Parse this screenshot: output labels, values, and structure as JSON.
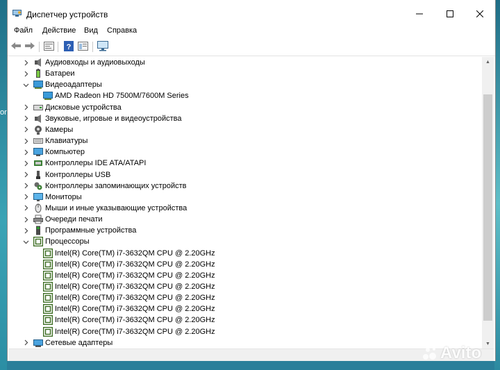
{
  "window": {
    "title": "Диспетчер устройств",
    "icon": "device-manager-icon",
    "controls": [
      "minimize-icon",
      "maximize-icon",
      "close-icon"
    ]
  },
  "menu": [
    "Файл",
    "Действие",
    "Вид",
    "Справка"
  ],
  "toolbar": [
    "back-arrow-icon",
    "forward-arrow-icon",
    "properties-icon",
    "help-icon",
    "view-icon",
    "monitor-scan-icon"
  ],
  "tree": [
    {
      "label": "Аудиовходы и аудиовыходы",
      "icon": "speaker-icon",
      "expanded": false
    },
    {
      "label": "Батареи",
      "icon": "battery-icon",
      "expanded": false
    },
    {
      "label": "Видеоадаптеры",
      "icon": "display-adapter-icon",
      "expanded": true
    },
    {
      "label": "AMD Radeon HD 7500M/7600M Series",
      "icon": "display-adapter-icon",
      "child": true
    },
    {
      "label": "Дисковые устройства",
      "icon": "disk-icon",
      "expanded": false
    },
    {
      "label": "Звуковые, игровые и видеоустройства",
      "icon": "speaker-icon",
      "expanded": false
    },
    {
      "label": "Камеры",
      "icon": "camera-icon",
      "expanded": false
    },
    {
      "label": "Клавиатуры",
      "icon": "keyboard-icon",
      "expanded": false
    },
    {
      "label": "Компьютер",
      "icon": "computer-icon",
      "expanded": false
    },
    {
      "label": "Контроллеры IDE ATA/ATAPI",
      "icon": "ide-controller-icon",
      "expanded": false
    },
    {
      "label": "Контроллеры USB",
      "icon": "usb-icon",
      "expanded": false
    },
    {
      "label": "Контроллеры запоминающих устройств",
      "icon": "storage-controller-icon",
      "expanded": false
    },
    {
      "label": "Мониторы",
      "icon": "monitor-icon",
      "expanded": false
    },
    {
      "label": "Мыши и иные указывающие устройства",
      "icon": "mouse-icon",
      "expanded": false
    },
    {
      "label": "Очереди печати",
      "icon": "printer-icon",
      "expanded": false
    },
    {
      "label": "Программные устройства",
      "icon": "software-device-icon",
      "expanded": false
    },
    {
      "label": "Процессоры",
      "icon": "processor-icon",
      "expanded": true
    },
    {
      "label": "Intel(R) Core(TM) i7-3632QM CPU @ 2.20GHz",
      "icon": "processor-icon",
      "child": true
    },
    {
      "label": "Intel(R) Core(TM) i7-3632QM CPU @ 2.20GHz",
      "icon": "processor-icon",
      "child": true
    },
    {
      "label": "Intel(R) Core(TM) i7-3632QM CPU @ 2.20GHz",
      "icon": "processor-icon",
      "child": true
    },
    {
      "label": "Intel(R) Core(TM) i7-3632QM CPU @ 2.20GHz",
      "icon": "processor-icon",
      "child": true
    },
    {
      "label": "Intel(R) Core(TM) i7-3632QM CPU @ 2.20GHz",
      "icon": "processor-icon",
      "child": true
    },
    {
      "label": "Intel(R) Core(TM) i7-3632QM CPU @ 2.20GHz",
      "icon": "processor-icon",
      "child": true
    },
    {
      "label": "Intel(R) Core(TM) i7-3632QM CPU @ 2.20GHz",
      "icon": "processor-icon",
      "child": true
    },
    {
      "label": "Intel(R) Core(TM) i7-3632QM CPU @ 2.20GHz",
      "icon": "processor-icon",
      "child": true
    },
    {
      "label": "Сетевые адаптеры",
      "icon": "network-adapter-icon",
      "expanded": false
    }
  ],
  "desktop": {
    "glyph": "or"
  },
  "watermark": "Avito",
  "colors": {
    "accent": "#1a73c7",
    "processor": "#3a6b1f",
    "selection": "#cce8ff"
  }
}
